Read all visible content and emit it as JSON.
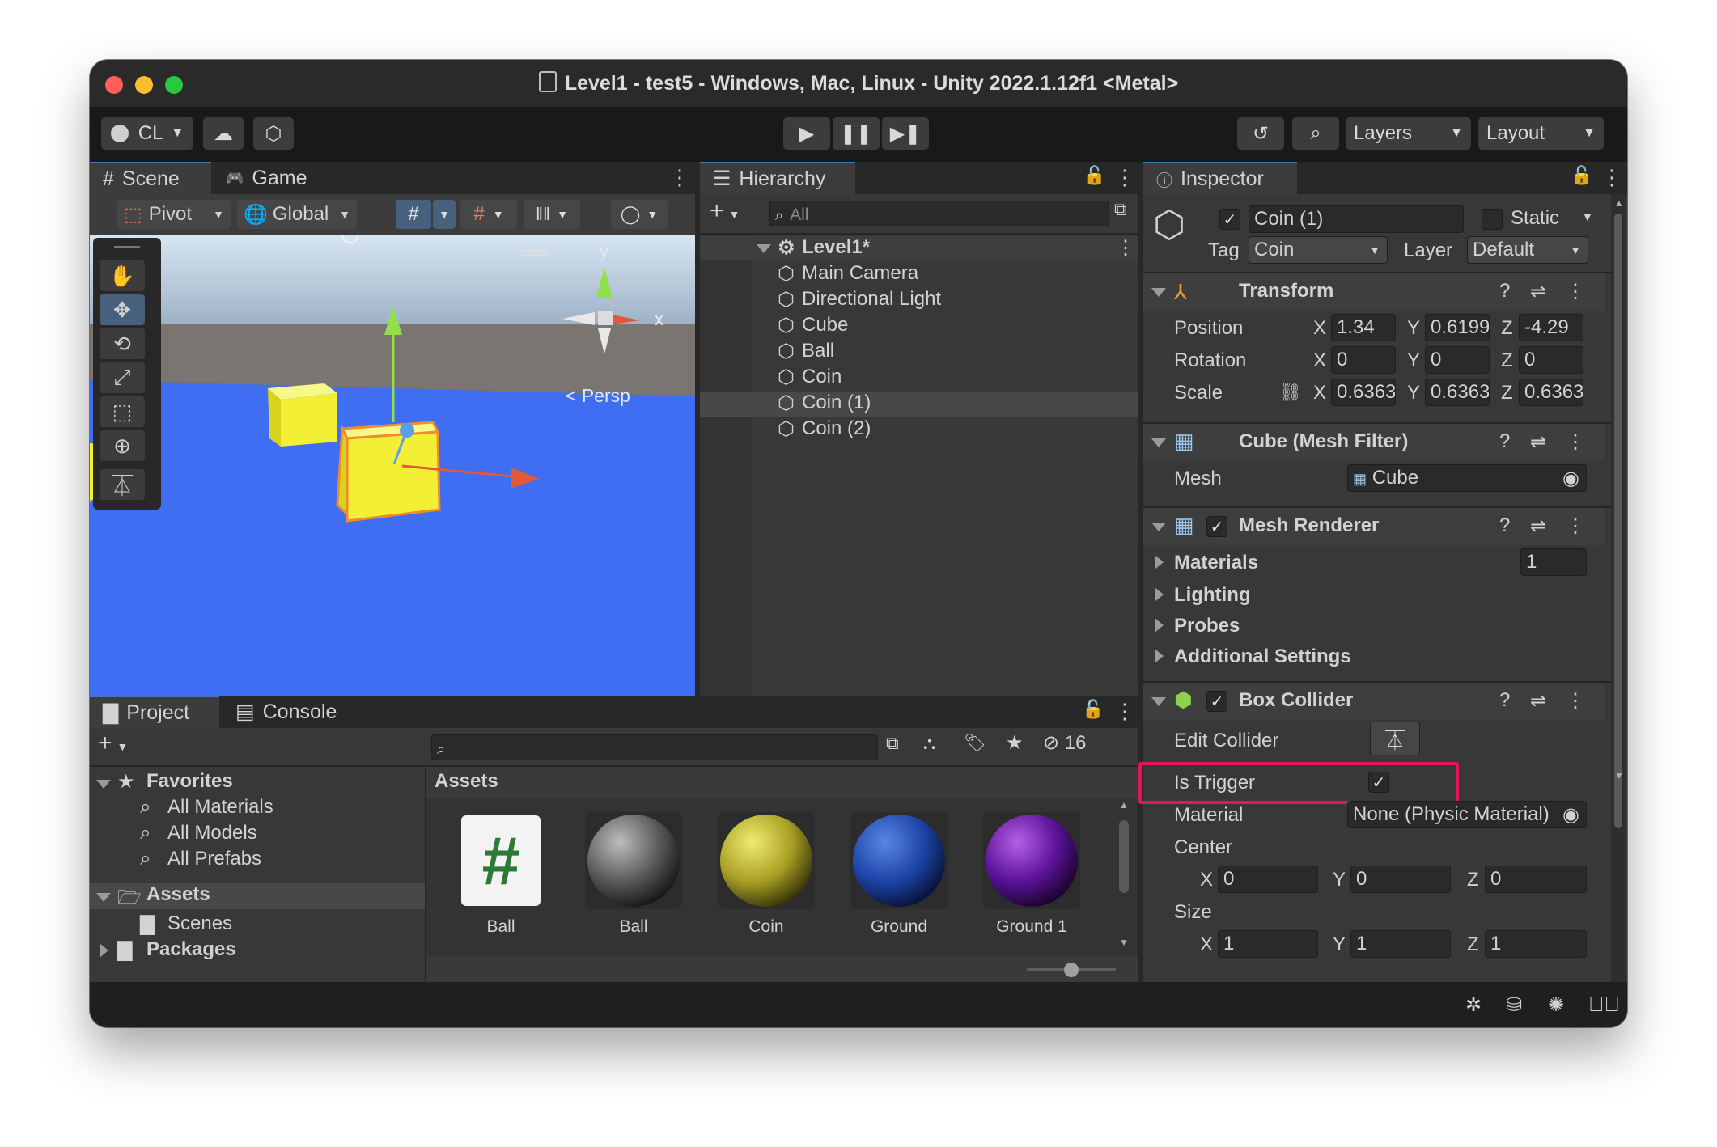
{
  "window": {
    "title": "Level1 - test5 - Windows, Mac, Linux - Unity 2022.1.12f1 <Metal>"
  },
  "toolbar": {
    "account": "CL",
    "layers": "Layers",
    "layout": "Layout"
  },
  "scene": {
    "tab_scene": "Scene",
    "tab_game": "Game",
    "pivot": "Pivot",
    "global": "Global",
    "persp": "< Persp",
    "gizmo_y": "y",
    "gizmo_x": "x"
  },
  "hierarchy": {
    "tab": "Hierarchy",
    "search_placeholder": "All",
    "root": "Level1*",
    "items": [
      "Main Camera",
      "Directional Light",
      "Cube",
      "Ball",
      "Coin",
      "Coin (1)",
      "Coin (2)"
    ]
  },
  "inspector": {
    "tab": "Inspector",
    "object_name": "Coin (1)",
    "static_label": "Static",
    "tag_label": "Tag",
    "tag_value": "Coin",
    "layer_label": "Layer",
    "layer_value": "Default",
    "transform": {
      "title": "Transform",
      "position_label": "Position",
      "rotation_label": "Rotation",
      "scale_label": "Scale",
      "position": {
        "x": "1.34",
        "y": "0.6199",
        "z": "-4.29"
      },
      "rotation": {
        "x": "0",
        "y": "0",
        "z": "0"
      },
      "scale": {
        "x": "0.6363",
        "y": "0.6363",
        "z": "0.6363"
      },
      "axis_x": "X",
      "axis_y": "Y",
      "axis_z": "Z"
    },
    "mesh_filter": {
      "title": "Cube (Mesh Filter)",
      "mesh_label": "Mesh",
      "mesh_value": "Cube"
    },
    "mesh_renderer": {
      "title": "Mesh Renderer",
      "materials": "Materials",
      "materials_count": "1",
      "lighting": "Lighting",
      "probes": "Probes",
      "additional": "Additional Settings"
    },
    "box_collider": {
      "title": "Box Collider",
      "edit_collider": "Edit Collider",
      "is_trigger": "Is Trigger",
      "material_label": "Material",
      "material_value": "None (Physic Material)",
      "center_label": "Center",
      "size_label": "Size",
      "center": {
        "x": "0",
        "y": "0",
        "z": "0"
      },
      "size": {
        "x": "1",
        "y": "1",
        "z": "1"
      }
    }
  },
  "project": {
    "tab_project": "Project",
    "tab_console": "Console",
    "hidden_count": "16",
    "favorites": "Favorites",
    "fav_items": [
      "All Materials",
      "All Models",
      "All Prefabs"
    ],
    "assets": "Assets",
    "scenes": "Scenes",
    "packages": "Packages",
    "breadcrumb": "Assets",
    "asset_items": [
      "Ball",
      "Ball",
      "Coin",
      "Ground",
      "Ground 1"
    ]
  },
  "colors": {
    "accent": "#3a79bb",
    "highlight": "#e0185a",
    "scene_blue": "#3f6ef2",
    "coin_yellow": "#f3ef35"
  }
}
